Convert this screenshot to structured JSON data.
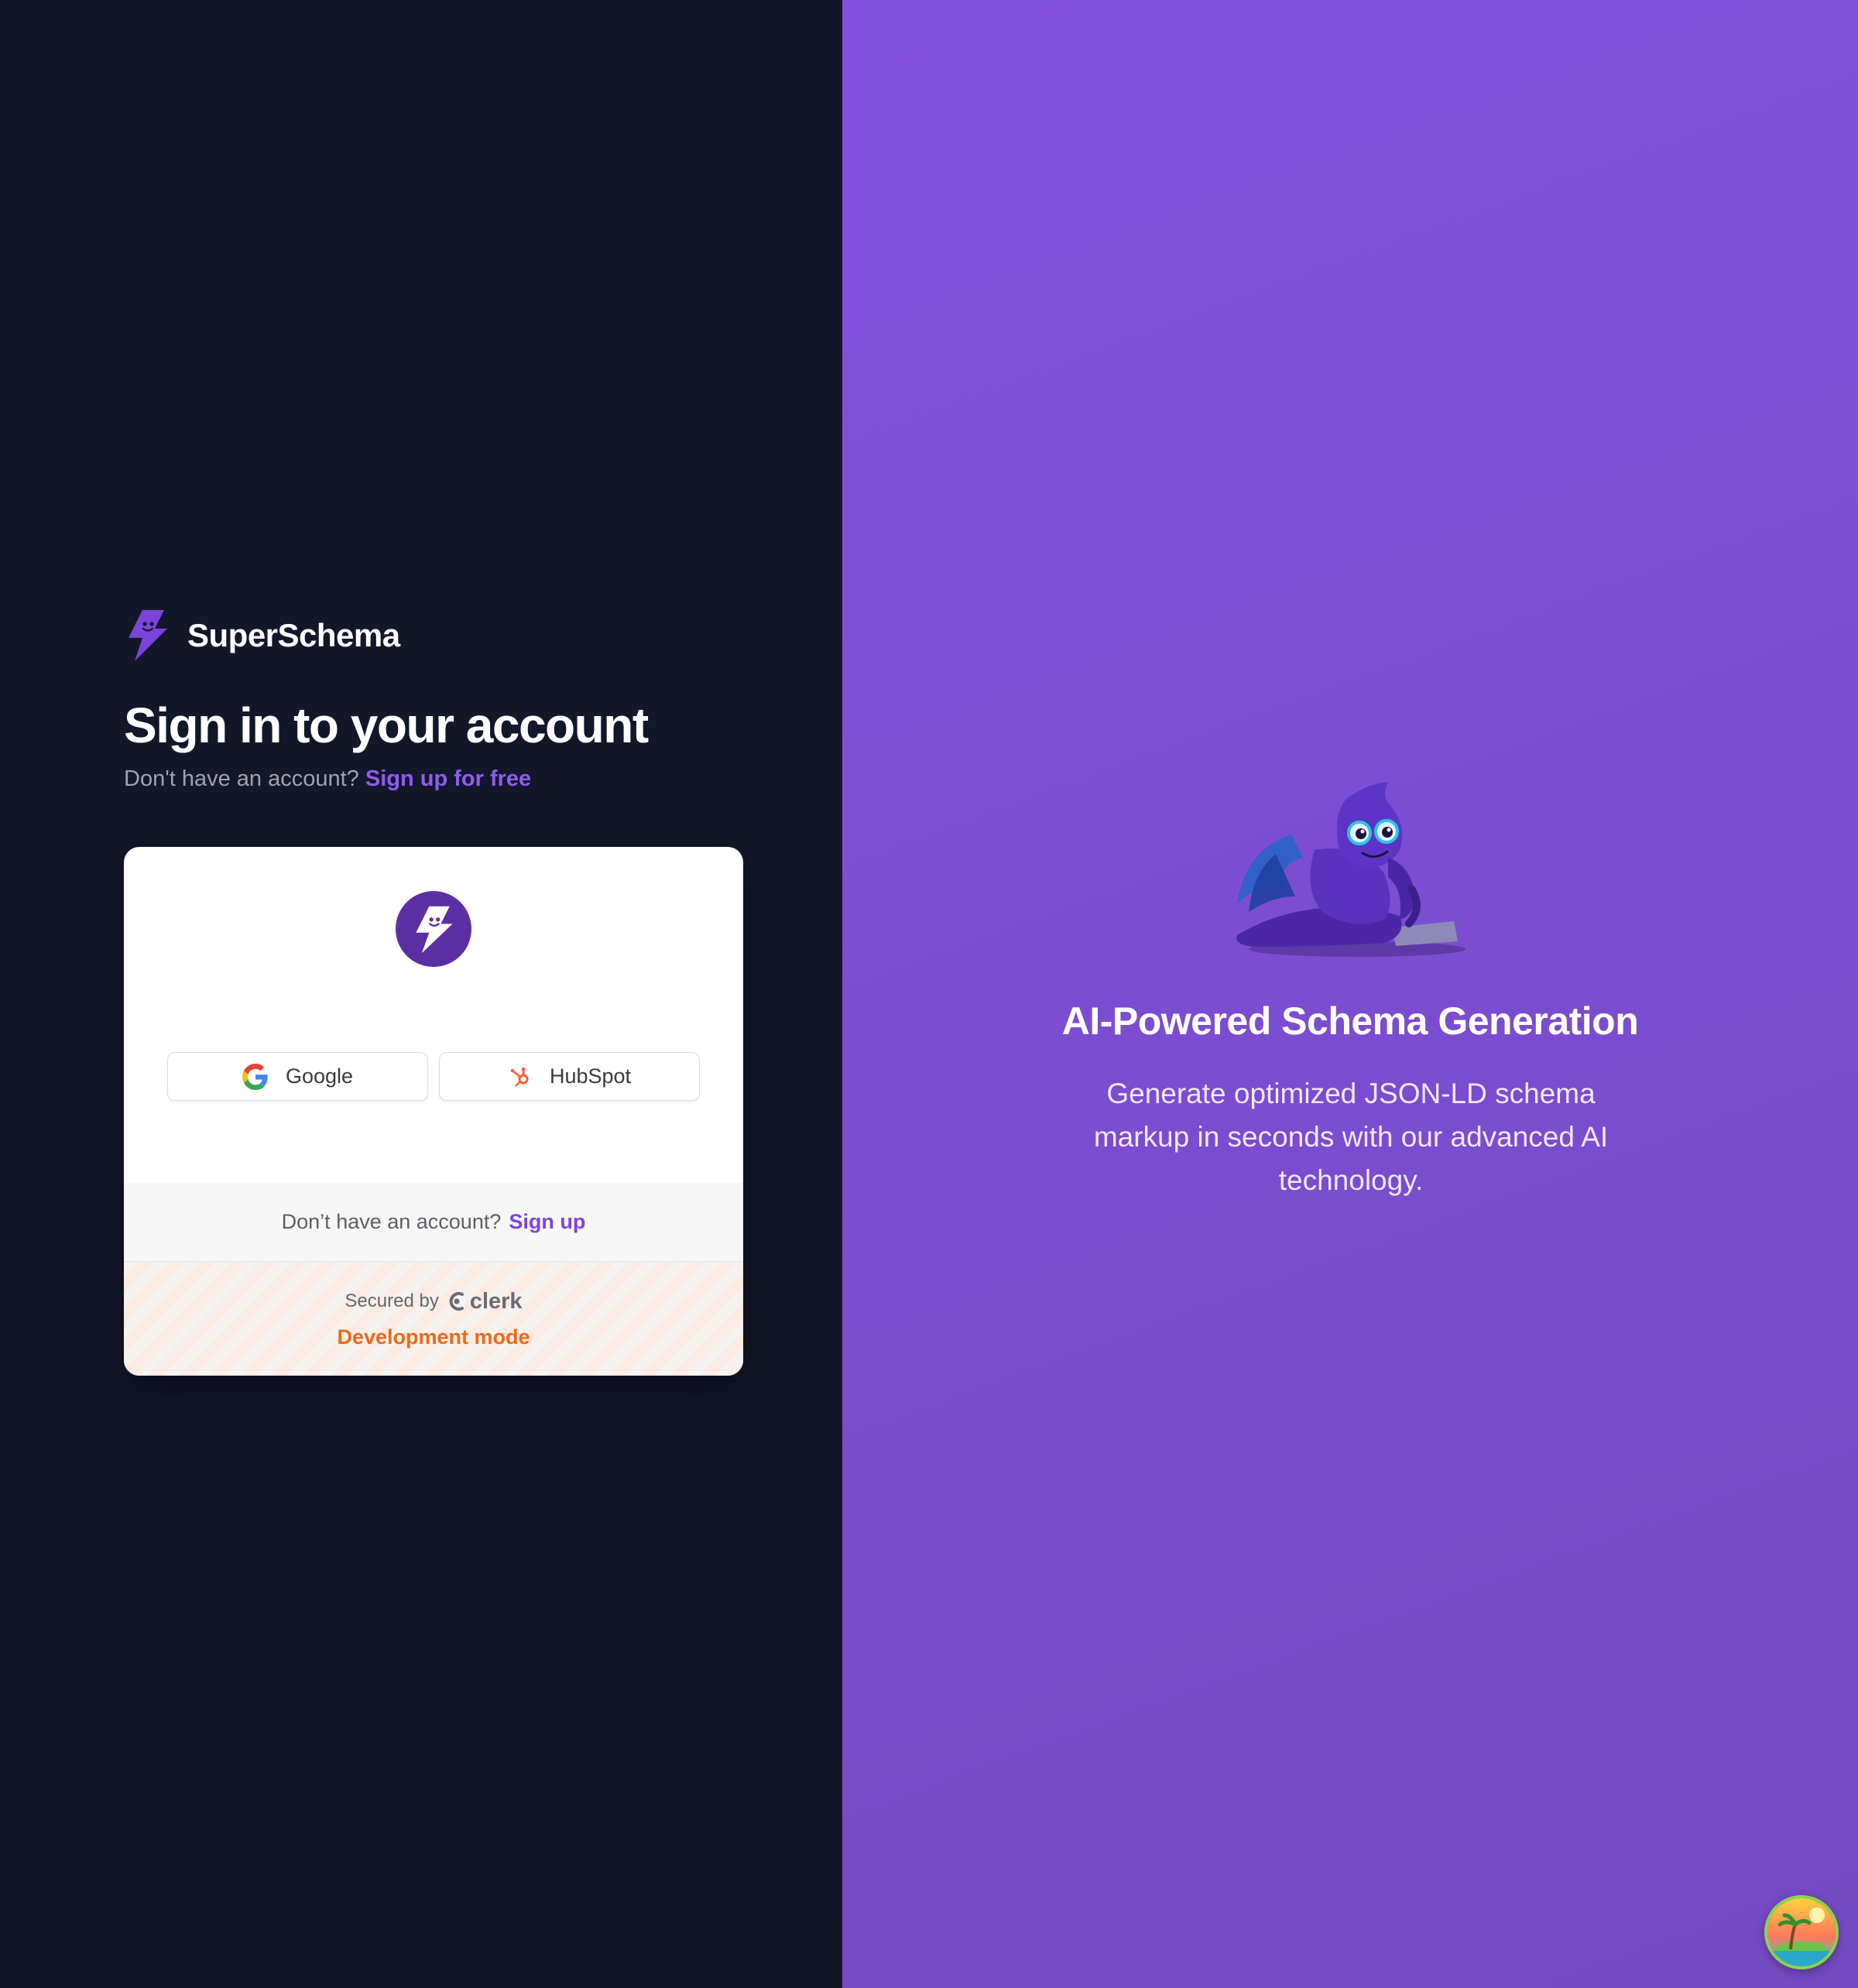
{
  "brand": {
    "name": "SuperSchema"
  },
  "signin": {
    "heading": "Sign in to your account",
    "no_account_text": "Don't have an account?",
    "signup_free_link": "Sign up for free"
  },
  "card": {
    "google_label": "Google",
    "hubspot_label": "HubSpot",
    "footer_question": "Don’t have an account?",
    "footer_signup_link": "Sign up",
    "secured_by": "Secured by",
    "clerk_brand": "clerk",
    "dev_mode": "Development mode"
  },
  "promo": {
    "title": "AI-Powered Schema Generation",
    "description": "Generate optimized JSON-LD schema markup in seconds with our advanced AI technology."
  },
  "colors": {
    "left_bg": "#121729",
    "right_bg": "#7c4dd2",
    "accent": "#8f5cf0",
    "dev_mode": "#ec6a1a"
  },
  "icons": [
    "lightning-logo-icon",
    "google-icon",
    "hubspot-icon",
    "clerk-icon",
    "mascot-illustration",
    "island-icon"
  ]
}
